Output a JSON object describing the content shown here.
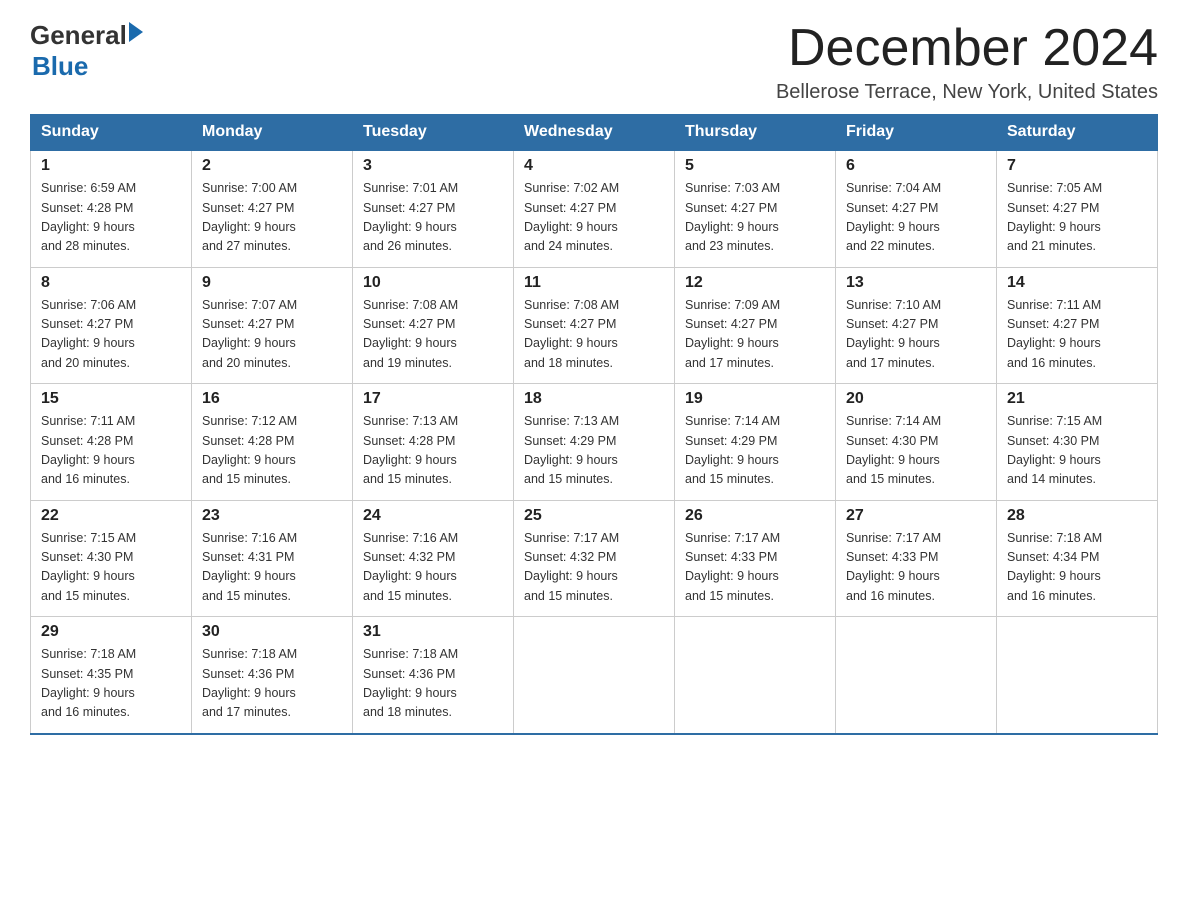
{
  "logo": {
    "text_general": "General",
    "arrow": "▶",
    "text_blue": "Blue"
  },
  "title": {
    "month": "December 2024",
    "location": "Bellerose Terrace, New York, United States"
  },
  "headers": [
    "Sunday",
    "Monday",
    "Tuesday",
    "Wednesday",
    "Thursday",
    "Friday",
    "Saturday"
  ],
  "weeks": [
    [
      {
        "day": "1",
        "sunrise": "6:59 AM",
        "sunset": "4:28 PM",
        "daylight": "9 hours and 28 minutes."
      },
      {
        "day": "2",
        "sunrise": "7:00 AM",
        "sunset": "4:27 PM",
        "daylight": "9 hours and 27 minutes."
      },
      {
        "day": "3",
        "sunrise": "7:01 AM",
        "sunset": "4:27 PM",
        "daylight": "9 hours and 26 minutes."
      },
      {
        "day": "4",
        "sunrise": "7:02 AM",
        "sunset": "4:27 PM",
        "daylight": "9 hours and 24 minutes."
      },
      {
        "day": "5",
        "sunrise": "7:03 AM",
        "sunset": "4:27 PM",
        "daylight": "9 hours and 23 minutes."
      },
      {
        "day": "6",
        "sunrise": "7:04 AM",
        "sunset": "4:27 PM",
        "daylight": "9 hours and 22 minutes."
      },
      {
        "day": "7",
        "sunrise": "7:05 AM",
        "sunset": "4:27 PM",
        "daylight": "9 hours and 21 minutes."
      }
    ],
    [
      {
        "day": "8",
        "sunrise": "7:06 AM",
        "sunset": "4:27 PM",
        "daylight": "9 hours and 20 minutes."
      },
      {
        "day": "9",
        "sunrise": "7:07 AM",
        "sunset": "4:27 PM",
        "daylight": "9 hours and 20 minutes."
      },
      {
        "day": "10",
        "sunrise": "7:08 AM",
        "sunset": "4:27 PM",
        "daylight": "9 hours and 19 minutes."
      },
      {
        "day": "11",
        "sunrise": "7:08 AM",
        "sunset": "4:27 PM",
        "daylight": "9 hours and 18 minutes."
      },
      {
        "day": "12",
        "sunrise": "7:09 AM",
        "sunset": "4:27 PM",
        "daylight": "9 hours and 17 minutes."
      },
      {
        "day": "13",
        "sunrise": "7:10 AM",
        "sunset": "4:27 PM",
        "daylight": "9 hours and 17 minutes."
      },
      {
        "day": "14",
        "sunrise": "7:11 AM",
        "sunset": "4:27 PM",
        "daylight": "9 hours and 16 minutes."
      }
    ],
    [
      {
        "day": "15",
        "sunrise": "7:11 AM",
        "sunset": "4:28 PM",
        "daylight": "9 hours and 16 minutes."
      },
      {
        "day": "16",
        "sunrise": "7:12 AM",
        "sunset": "4:28 PM",
        "daylight": "9 hours and 15 minutes."
      },
      {
        "day": "17",
        "sunrise": "7:13 AM",
        "sunset": "4:28 PM",
        "daylight": "9 hours and 15 minutes."
      },
      {
        "day": "18",
        "sunrise": "7:13 AM",
        "sunset": "4:29 PM",
        "daylight": "9 hours and 15 minutes."
      },
      {
        "day": "19",
        "sunrise": "7:14 AM",
        "sunset": "4:29 PM",
        "daylight": "9 hours and 15 minutes."
      },
      {
        "day": "20",
        "sunrise": "7:14 AM",
        "sunset": "4:30 PM",
        "daylight": "9 hours and 15 minutes."
      },
      {
        "day": "21",
        "sunrise": "7:15 AM",
        "sunset": "4:30 PM",
        "daylight": "9 hours and 14 minutes."
      }
    ],
    [
      {
        "day": "22",
        "sunrise": "7:15 AM",
        "sunset": "4:30 PM",
        "daylight": "9 hours and 15 minutes."
      },
      {
        "day": "23",
        "sunrise": "7:16 AM",
        "sunset": "4:31 PM",
        "daylight": "9 hours and 15 minutes."
      },
      {
        "day": "24",
        "sunrise": "7:16 AM",
        "sunset": "4:32 PM",
        "daylight": "9 hours and 15 minutes."
      },
      {
        "day": "25",
        "sunrise": "7:17 AM",
        "sunset": "4:32 PM",
        "daylight": "9 hours and 15 minutes."
      },
      {
        "day": "26",
        "sunrise": "7:17 AM",
        "sunset": "4:33 PM",
        "daylight": "9 hours and 15 minutes."
      },
      {
        "day": "27",
        "sunrise": "7:17 AM",
        "sunset": "4:33 PM",
        "daylight": "9 hours and 16 minutes."
      },
      {
        "day": "28",
        "sunrise": "7:18 AM",
        "sunset": "4:34 PM",
        "daylight": "9 hours and 16 minutes."
      }
    ],
    [
      {
        "day": "29",
        "sunrise": "7:18 AM",
        "sunset": "4:35 PM",
        "daylight": "9 hours and 16 minutes."
      },
      {
        "day": "30",
        "sunrise": "7:18 AM",
        "sunset": "4:36 PM",
        "daylight": "9 hours and 17 minutes."
      },
      {
        "day": "31",
        "sunrise": "7:18 AM",
        "sunset": "4:36 PM",
        "daylight": "9 hours and 18 minutes."
      },
      null,
      null,
      null,
      null
    ]
  ],
  "labels": {
    "sunrise": "Sunrise:",
    "sunset": "Sunset:",
    "daylight": "Daylight:"
  }
}
